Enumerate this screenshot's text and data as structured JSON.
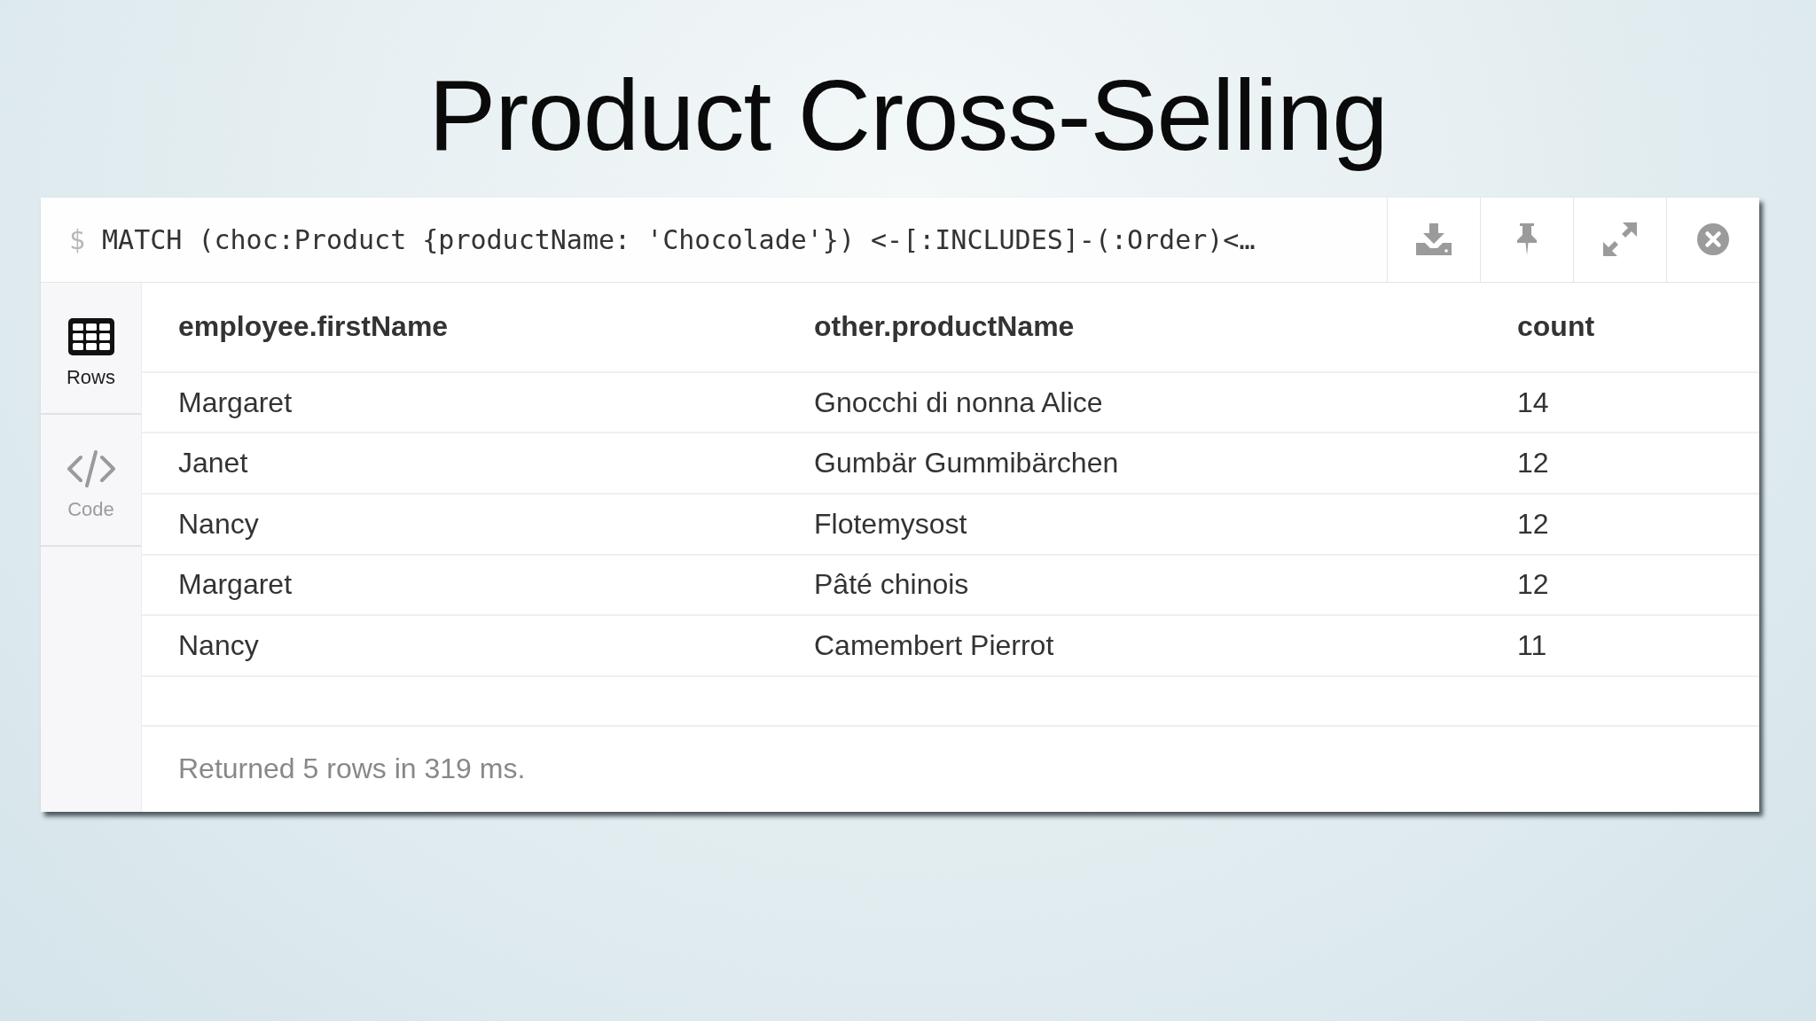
{
  "slide": {
    "title": "Product Cross-Selling"
  },
  "query_bar": {
    "prompt": "$",
    "query": "MATCH (choc:Product {productName: 'Chocolade'}) <-[:INCLUDES]-(:Order)<…"
  },
  "view_tabs": [
    {
      "kind": "table",
      "label": "Rows",
      "selected": true
    },
    {
      "kind": "code",
      "label": "Code",
      "selected": false
    }
  ],
  "table": {
    "columns": [
      "employee.firstName",
      "other.productName",
      "count"
    ],
    "rows": [
      [
        "Margaret",
        "Gnocchi di nonna Alice",
        "14"
      ],
      [
        "Janet",
        "Gumbär Gummibärchen",
        "12"
      ],
      [
        "Nancy",
        "Flotemysost",
        "12"
      ],
      [
        "Margaret",
        "Pâté chinois",
        "12"
      ],
      [
        "Nancy",
        "Camembert Pierrot",
        "11"
      ]
    ]
  },
  "status": "Returned 5 rows in 319 ms."
}
